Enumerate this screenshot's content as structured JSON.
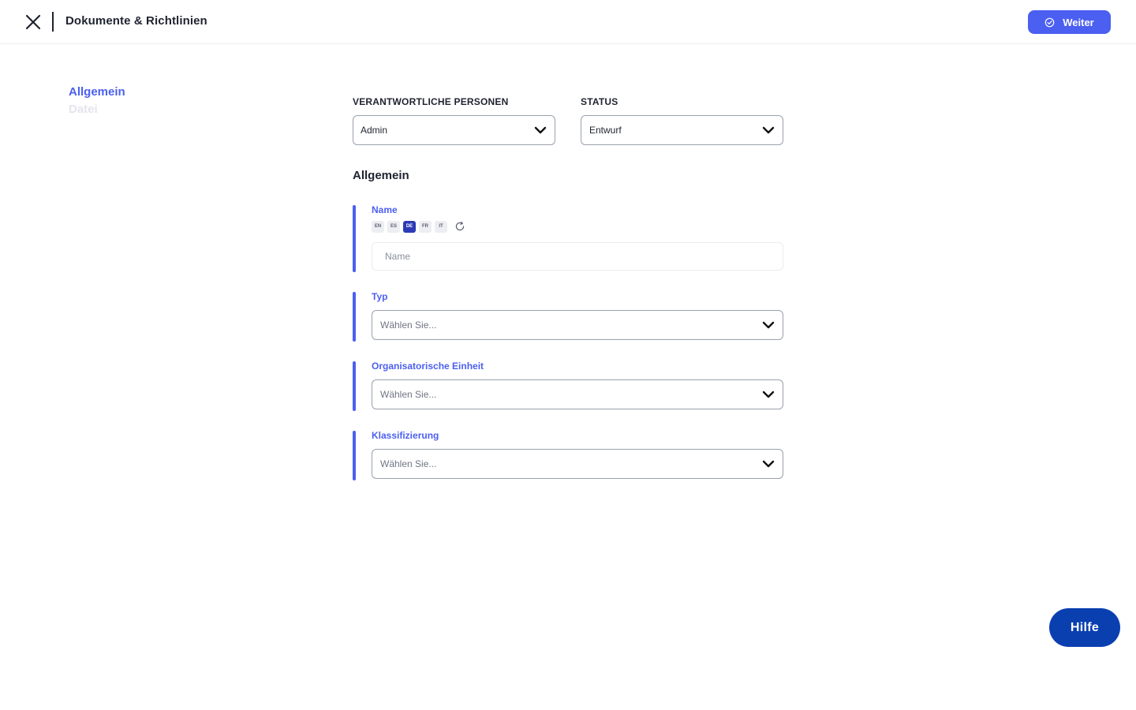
{
  "header": {
    "title": "Dokumente & Richtlinien",
    "next_label": "Weiter"
  },
  "sidenav": {
    "items": [
      {
        "label": "Allgemein",
        "active": true
      },
      {
        "label": "Datei",
        "active": false
      }
    ]
  },
  "top_fields": {
    "responsible": {
      "label": "VERANTWORTLICHE PERSONEN",
      "value": "Admin"
    },
    "status": {
      "label": "STATUS",
      "value": "Entwurf"
    }
  },
  "section": {
    "title": "Allgemein",
    "name": {
      "label": "Name",
      "placeholder": "Name",
      "value": "",
      "languages": [
        "EN",
        "ES",
        "DE",
        "FR",
        "IT"
      ],
      "active_language": "DE"
    },
    "type": {
      "label": "Typ",
      "placeholder": "Wählen Sie..."
    },
    "org_unit": {
      "label": "Organisatorische Einheit",
      "placeholder": "Wählen Sie..."
    },
    "classification": {
      "label": "Klassifizierung",
      "placeholder": "Wählen Sie..."
    }
  },
  "help": {
    "label": "Hilfe"
  },
  "colors": {
    "accent": "#4b5ff0",
    "help_button": "#0a3fb0",
    "active_language_chip": "#2c3ab6"
  },
  "icons": {
    "close": "close-icon",
    "next": "check-circle-icon",
    "dropdown": "chevron-down-icon",
    "refresh": "refresh-icon"
  }
}
